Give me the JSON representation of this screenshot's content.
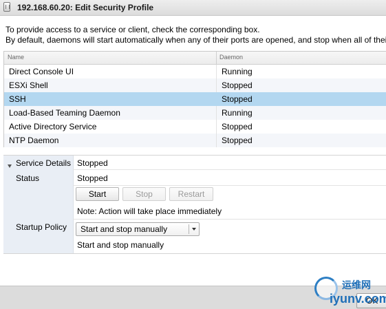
{
  "window": {
    "title": "192.168.60.20: Edit Security Profile"
  },
  "intro": {
    "line1": "To provide access to a service or client, check the corresponding box.",
    "line2": "By default, daemons will start automatically when any of their ports are opened, and stop when all of their ports are c"
  },
  "table": {
    "headers": {
      "name": "Name",
      "daemon": "Daemon"
    },
    "rows": [
      {
        "name": "Direct Console UI",
        "daemon": "Running",
        "selected": false
      },
      {
        "name": "ESXi Shell",
        "daemon": "Stopped",
        "selected": false
      },
      {
        "name": "SSH",
        "daemon": "Stopped",
        "selected": true
      },
      {
        "name": "Load-Based Teaming Daemon",
        "daemon": "Running",
        "selected": false
      },
      {
        "name": "Active Directory Service",
        "daemon": "Stopped",
        "selected": false
      },
      {
        "name": "NTP Daemon",
        "daemon": "Stopped",
        "selected": false
      }
    ]
  },
  "details": {
    "section_label": "Service Details",
    "section_value": "Stopped",
    "status_label": "Status",
    "status_value": "Stopped",
    "buttons": {
      "start": "Start",
      "stop": "Stop",
      "restart": "Restart"
    },
    "note": "Note: Action will take place immediately",
    "startup_policy_label": "Startup Policy",
    "startup_policy_selected": "Start and stop manually",
    "startup_policy_summary": "Start and stop manually"
  },
  "footer": {
    "ok_label": "OK"
  },
  "watermark": {
    "chinese_text": "运维网",
    "site_text": "iyunv.com"
  },
  "colors": {
    "selected_row": "#b3d7f0",
    "details_label_bg": "#e9eef5",
    "footer_bg": "#dcdcdc",
    "watermark_blue": "#1f6fb8"
  }
}
